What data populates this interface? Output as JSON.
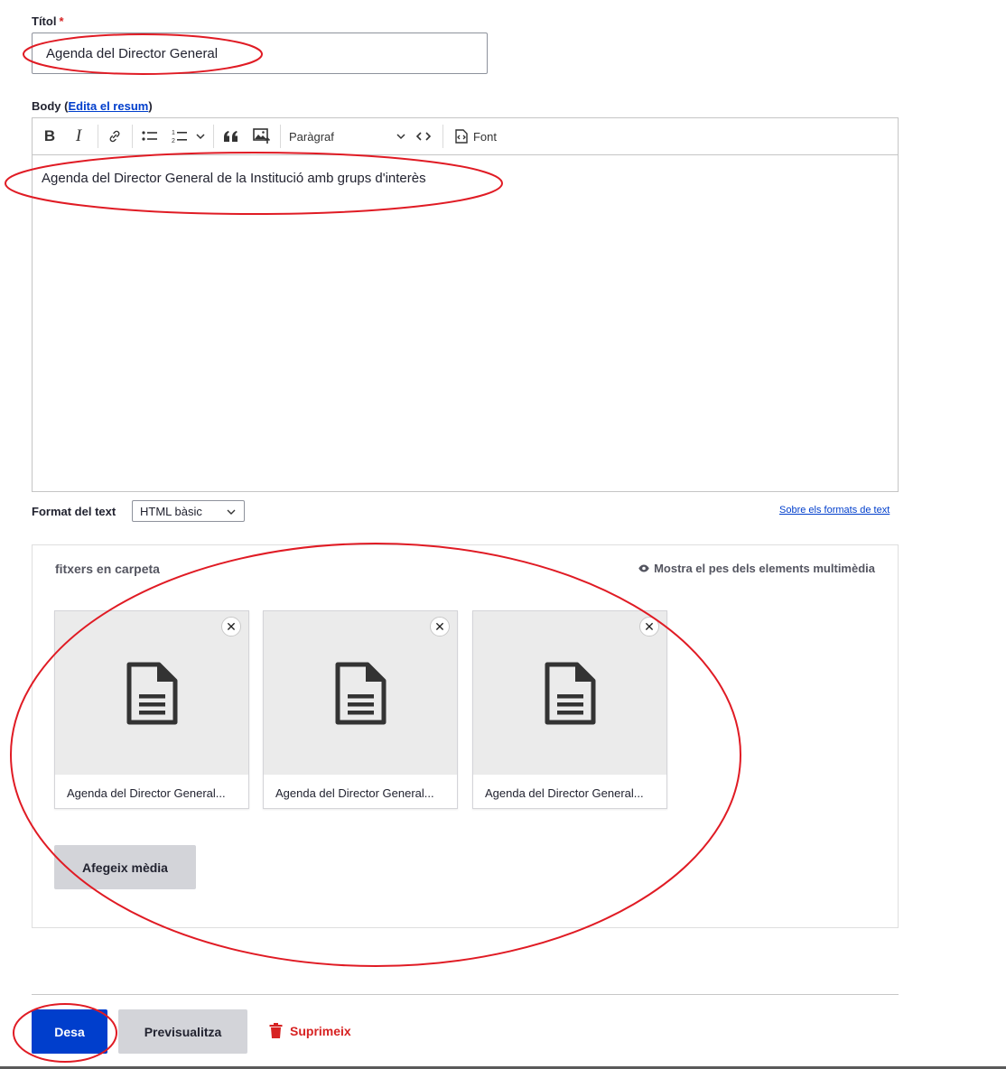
{
  "title_field": {
    "label": "Títol",
    "required_mark": "*",
    "value": "Agenda del Director General"
  },
  "body_field": {
    "label_prefix": "Body (",
    "summary_link": "Edita el resum",
    "label_suffix": ")",
    "toolbar": {
      "bold": "B",
      "italic": "I",
      "format_select": "Paràgraf",
      "source_label": "Font"
    },
    "content": "Agenda del Director General de la Institució amb grups d'interès"
  },
  "text_format": {
    "label": "Format del text",
    "selected": "HTML bàsic",
    "help_link": "Sobre els formats de text"
  },
  "media": {
    "title": "fitxers en carpeta",
    "weight_toggle": "Mostra el pes dels elements multimèdia",
    "items": [
      {
        "name": "Agenda del Director General..."
      },
      {
        "name": "Agenda del Director General..."
      },
      {
        "name": "Agenda del Director General..."
      }
    ],
    "remove_symbol": "✕",
    "add_button": "Afegeix mèdia"
  },
  "actions": {
    "save": "Desa",
    "preview": "Previsualitza",
    "delete": "Suprimeix"
  },
  "colors": {
    "primary": "#003ecc",
    "danger": "#d72222",
    "annotation": "#e01b24"
  }
}
